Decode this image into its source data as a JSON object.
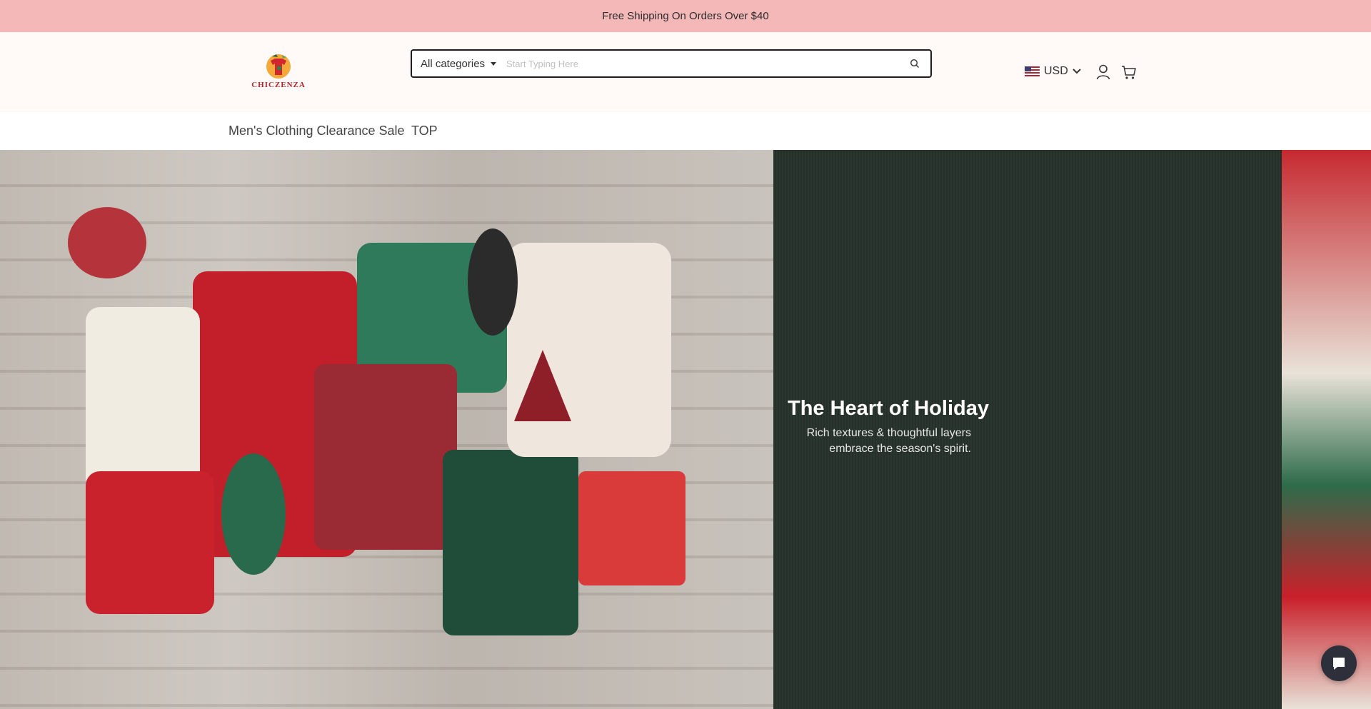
{
  "announcement": {
    "text": "Free Shipping On Orders Over $40"
  },
  "header": {
    "logo_text": "CHICZENZA",
    "search": {
      "category_label": "All categories",
      "placeholder": "Start Typing Here",
      "value": ""
    },
    "currency": {
      "code": "USD",
      "flag_icon": "us-flag-icon"
    },
    "icons": [
      "user-icon",
      "cart-icon",
      "search-icon",
      "chevron-down-icon"
    ]
  },
  "nav": {
    "items": [
      {
        "label": "Men's Clothing Clearance Sale"
      },
      {
        "label": "TOP"
      }
    ]
  },
  "hero": {
    "title": "The Heart of Holiday",
    "subtitle_line1": "Rich textures & thoughtful layers",
    "subtitle_line2": "embrace the season's spirit."
  },
  "colors": {
    "announcement_bg": "#f5b8b9",
    "header_bg": "#fffaf7",
    "hero_panel_bg": "#27322b",
    "logo_red": "#b3262c",
    "chat_bg": "#2d2f3b"
  },
  "chat": {
    "icon": "chat-icon"
  }
}
